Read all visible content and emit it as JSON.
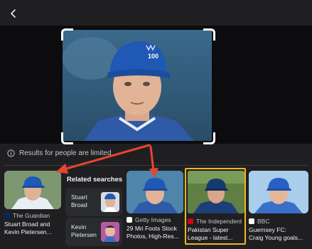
{
  "header": {
    "back_icon": "arrow-left-icon"
  },
  "notice": {
    "text": "Results for people are limited",
    "icon": "info-icon"
  },
  "related": {
    "title": "Related searches",
    "chips": [
      {
        "label_line1": "Stuart",
        "label_line2": "Broad"
      },
      {
        "label_line1": "Kevin",
        "label_line2": "Pietersen"
      }
    ]
  },
  "results": [
    {
      "source": "The Guardian",
      "caption_line1": "Stuart Broad and",
      "caption_line2": "Kevin Pietersen..."
    },
    {
      "source": "Getty Images",
      "caption_line1": "29 Mri Foots Stock",
      "caption_line2": "Photos, High-Res..."
    },
    {
      "source": "The Independent",
      "caption_line1": "Pakistan Super",
      "caption_line2": "League - latest..."
    },
    {
      "source": "BBC",
      "caption_line1": "Guernsey FC:",
      "caption_line2": "Craig Young goals..."
    }
  ],
  "colors": {
    "highlight": "#f2b51b",
    "arrow": "#e8452f",
    "background": "#1f1f22"
  }
}
